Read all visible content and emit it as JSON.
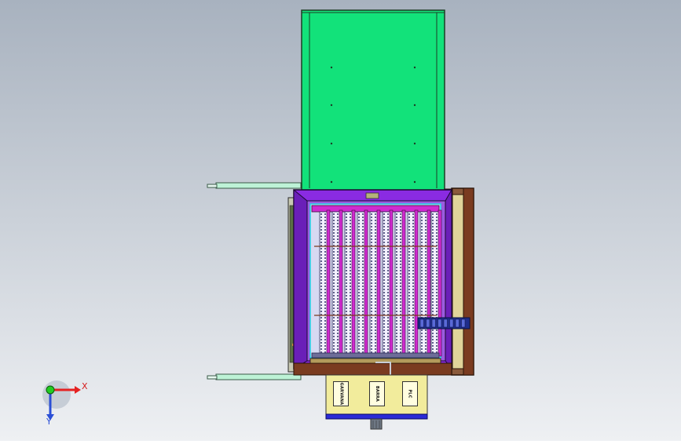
{
  "viewport": {
    "background_top": "#a8b2bf",
    "background_bottom": "#eef0f3"
  },
  "colors": {
    "lid_green": "#12e27a",
    "frame_purple": "#8a2be2",
    "rack_magenta": "#d02ad0",
    "base_brown": "#7a3b20",
    "panel_yellow": "#f2ec9c",
    "stripe_blue": "#2b2bd6",
    "tray_navy": "#1f2d8c",
    "rail_mint": "#bdf2d6",
    "accent_cyan": "#22d6e6"
  },
  "control_panel": {
    "labels": [
      "GARVANA",
      "BARRA",
      "PLC"
    ]
  },
  "triad": {
    "x_label": "X",
    "y_label": "Y",
    "x_color": "#e52222",
    "y_color": "#2b4fd6",
    "z_color": "#22cc22"
  }
}
